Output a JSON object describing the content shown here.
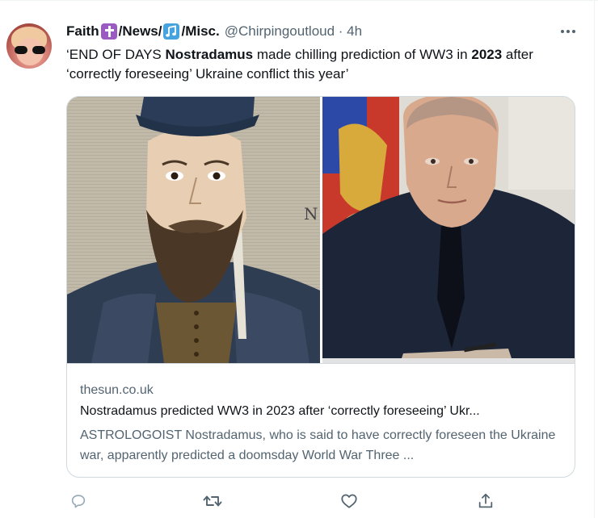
{
  "tweet": {
    "display_name_parts": [
      "Faith ",
      "/News/",
      "/Misc."
    ],
    "name_emoji_icons": [
      "latin-cross-emoji-icon",
      "musical-notes-emoji-icon"
    ],
    "handle": "@Chirpingoutloud",
    "separator": " · ",
    "time": "4h",
    "text_parts": [
      "‘END OF DAYS ",
      "Nostradamus",
      " made chilling prediction of WW3 in ",
      "2023",
      " after ‘correctly foreseeing’ Ukraine conflict this year’"
    ]
  },
  "card": {
    "domain": "thesun.co.uk",
    "title": "Nostradamus predicted WW3 in 2023 after ‘correctly foreseeing’ Ukr...",
    "description": "ASTROLOGOIST Nostradamus, who is said to have correctly foreseen the Ukraine war, apparently predicted a doomsday World War Three ...",
    "images": [
      "nostradamus-portrait",
      "putin-photo"
    ]
  },
  "actions": {
    "icons": [
      "reply-icon",
      "retweet-icon",
      "like-icon",
      "share-icon"
    ]
  },
  "colors": {
    "text": "#0f1419",
    "secondary": "#536471",
    "border": "#cfd9de",
    "reply_icon": "#9aabb8"
  }
}
